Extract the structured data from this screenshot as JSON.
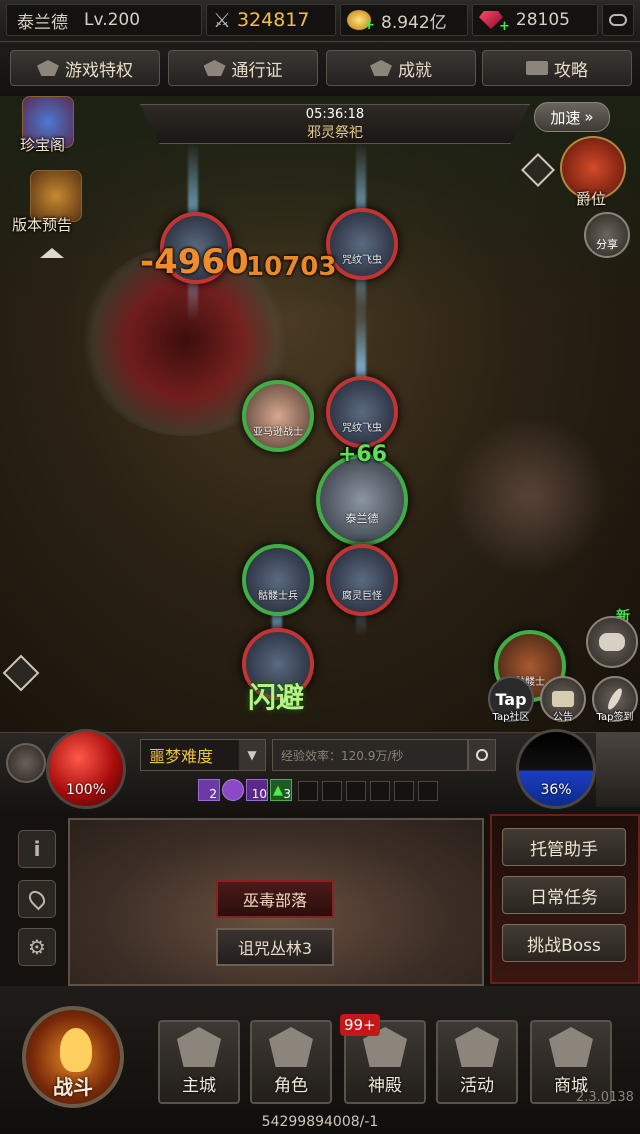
{
  "top_bar": {
    "player_name": "泰兰德",
    "level": "Lv.200",
    "combat_power": "324817",
    "gold": "8.942亿",
    "gems": "28105"
  },
  "tabs": [
    {
      "label": "游戏特权",
      "icon": "gem-icon"
    },
    {
      "label": "通行证",
      "icon": "crown-icon"
    },
    {
      "label": "成就",
      "icon": "trophy-icon"
    },
    {
      "label": "攻略",
      "icon": "book-icon"
    }
  ],
  "left_icons": {
    "treasure": "珍宝阁",
    "preview": "版本预告"
  },
  "right_icons": {
    "speed": "加速",
    "rank": "爵位",
    "share": "分享"
  },
  "event": {
    "time": "05:36:18",
    "name": "邪灵祭祀"
  },
  "units": {
    "u1": "",
    "u2": "咒纹飞虫",
    "u3": "亚马逊战士",
    "u4": "咒纹飞虫",
    "u5": "泰兰德",
    "u6": "骷髅士兵",
    "u7": "腐灵巨怪",
    "u8": "",
    "u9": "骷髅士"
  },
  "combat_text": {
    "damage1": "-4960",
    "damage2": "10703",
    "heal": "+66",
    "dodge": "闪避"
  },
  "social": {
    "new_badge": "新",
    "tap_logo": "Tap",
    "tap_community": "Tap社区",
    "notice": "公告",
    "tap_checkin": "Tap签到"
  },
  "hud": {
    "hp_percent": "100%",
    "mp_percent": "36%",
    "difficulty": "噩梦难度",
    "exp_rate": "经验效率：120.9万/秒",
    "buffs": [
      "2",
      "",
      "10",
      "3"
    ]
  },
  "panel": {
    "zone_top": "巫毒部落",
    "zone_bottom": "诅咒丛林3",
    "right_buttons": [
      "托管助手",
      "日常任务",
      "挑战Boss"
    ]
  },
  "nav": {
    "battle": "战斗",
    "items": [
      "主城",
      "角色",
      "神殿",
      "活动",
      "商城"
    ],
    "badge": "99+",
    "footer": "54299894008/-1",
    "version": "2.3.0138"
  },
  "colors": {
    "hp": "#c31a1a",
    "mp": "#1c3ec2",
    "enemy_ring": "#c23333",
    "ally_ring": "#3fae45",
    "heal": "#5fe05a",
    "damage": "#f09a2c"
  }
}
